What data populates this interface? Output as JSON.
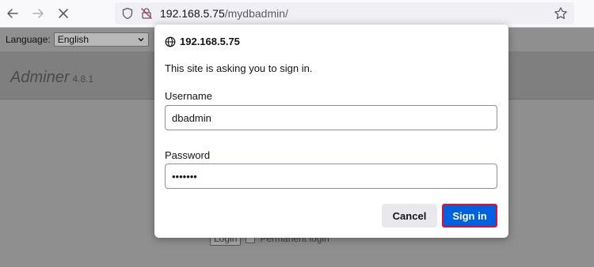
{
  "browser": {
    "url_host": "192.168.5.75",
    "url_path": "/mydbadmin/",
    "icons": {
      "back": "arrow-left-icon",
      "forward": "arrow-right-icon",
      "stop": "close-icon",
      "tracking": "shield-icon",
      "permissions": "lock-slash-icon",
      "bookmark": "star-icon"
    }
  },
  "page": {
    "language_label": "Language:",
    "language_value": "English",
    "app_name": "Adminer",
    "app_version": "4.8.1",
    "login_button": "Login",
    "permanent_login": "Permanent login"
  },
  "dialog": {
    "host": "192.168.5.75",
    "message": "This site is asking you to sign in.",
    "username_label": "Username",
    "username_value": "dbadmin",
    "password_label": "Password",
    "password_value": "•••••••",
    "cancel_label": "Cancel",
    "signin_label": "Sign in"
  },
  "colors": {
    "primary": "#0061e0",
    "highlight": "#e0102a"
  }
}
